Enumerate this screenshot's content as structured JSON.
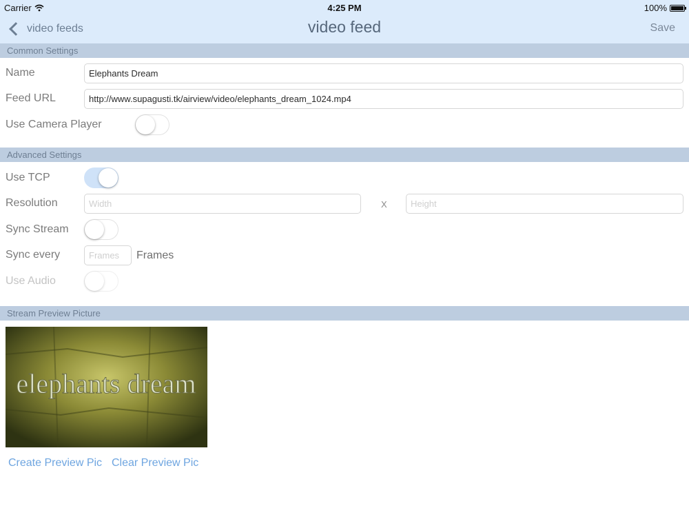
{
  "status_bar": {
    "carrier": "Carrier",
    "time": "4:25 PM",
    "battery": "100%",
    "wifi_icon": "wifi-icon",
    "battery_icon": "battery-icon"
  },
  "nav": {
    "back_label": "video feeds",
    "title": "video feed",
    "save_label": "Save"
  },
  "sections": {
    "common": "Common Settings",
    "advanced": "Advanced Settings",
    "preview": "Stream Preview Picture"
  },
  "common": {
    "name_label": "Name",
    "name_value": "Elephants Dream",
    "feed_url_label": "Feed URL",
    "feed_url_value": "http://www.supagusti.tk/airview/video/elephants_dream_1024.mp4",
    "camera_player_label": "Use Camera Player",
    "camera_player_on": false
  },
  "advanced": {
    "tcp_label": "Use TCP",
    "tcp_on": true,
    "resolution_label": "Resolution",
    "width_placeholder": "Width",
    "separator": "X",
    "height_placeholder": "Height",
    "sync_stream_label": "Sync Stream",
    "sync_stream_on": false,
    "sync_every_label": "Sync every",
    "frames_placeholder": "Frames",
    "frames_unit": "Frames",
    "audio_label": "Use Audio",
    "audio_on": false
  },
  "preview": {
    "image_text": "elephants dream",
    "create_label": "Create Preview Pic",
    "clear_label": "Clear Preview Pic"
  },
  "colors": {
    "nav_bg": "#dcebfb",
    "section_bg": "#bdcde0",
    "link": "#6ea5e0",
    "switch_on": "#cfe2f8"
  }
}
